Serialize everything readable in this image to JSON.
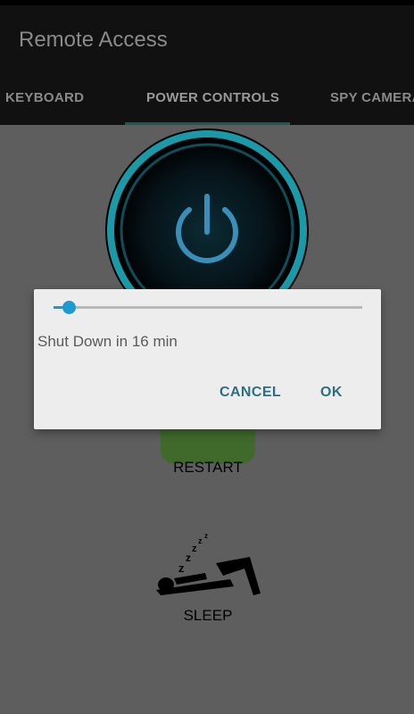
{
  "app": {
    "title": "Remote Access"
  },
  "tabs": [
    {
      "label": "KEYBOARD",
      "selected": false
    },
    {
      "label": "POWER CONTROLS",
      "selected": true
    },
    {
      "label": "SPY CAMERA",
      "selected": false
    }
  ],
  "controls": {
    "restart_label": "RESTART",
    "sleep_label": "SLEEP"
  },
  "dialog": {
    "message": "Shut Down in 16 min",
    "slider_fraction": 0.05,
    "cancel_label": "CANCEL",
    "ok_label": "OK"
  },
  "colors": {
    "accent": "#1e9ad3",
    "dialog_button": "#2d6f82",
    "tab_indicator": "#1a5a52"
  },
  "icons": [
    "power-icon",
    "restart-icon",
    "sleep-icon"
  ]
}
